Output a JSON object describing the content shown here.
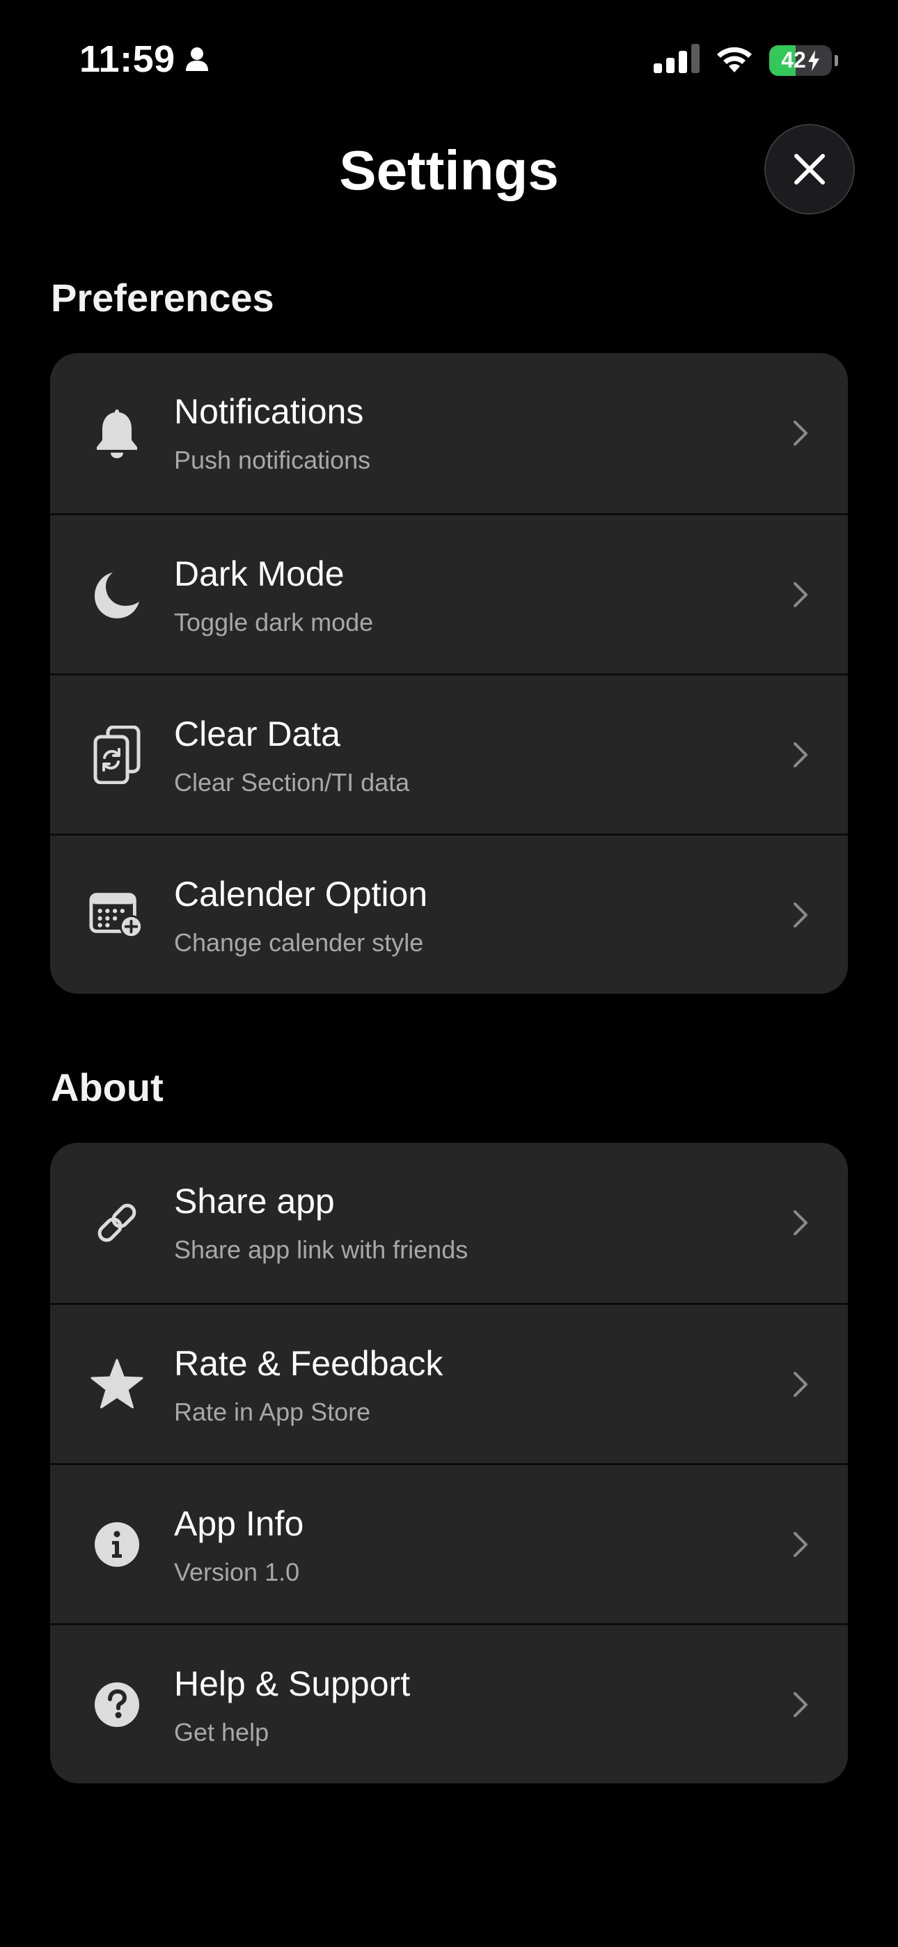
{
  "status_bar": {
    "time": "11:59",
    "battery_level": "42",
    "battery_fraction": 0.42
  },
  "header": {
    "title": "Settings"
  },
  "preferences": {
    "title": "Preferences",
    "items": [
      {
        "icon": "bell-icon",
        "title": "Notifications",
        "subtitle": "Push notifications"
      },
      {
        "icon": "moon-icon",
        "title": "Dark Mode",
        "subtitle": "Toggle dark mode"
      },
      {
        "icon": "clear-data-icon",
        "title": "Clear Data",
        "subtitle": "Clear Section/TI data"
      },
      {
        "icon": "calendar-add-icon",
        "title": "Calender Option",
        "subtitle": "Change calender style"
      }
    ]
  },
  "about": {
    "title": "About",
    "items": [
      {
        "icon": "link-icon",
        "title": "Share app",
        "subtitle": "Share app link with friends"
      },
      {
        "icon": "star-icon",
        "title": "Rate & Feedback",
        "subtitle": "Rate in App Store"
      },
      {
        "icon": "info-icon",
        "title": "App Info",
        "subtitle": "Version 1.0"
      },
      {
        "icon": "question-icon",
        "title": "Help & Support",
        "subtitle": "Get help"
      }
    ]
  },
  "colors": {
    "background": "#000000",
    "card": "#262626",
    "subtitle": "#a8a8a8",
    "battery_green": "#34c759"
  }
}
